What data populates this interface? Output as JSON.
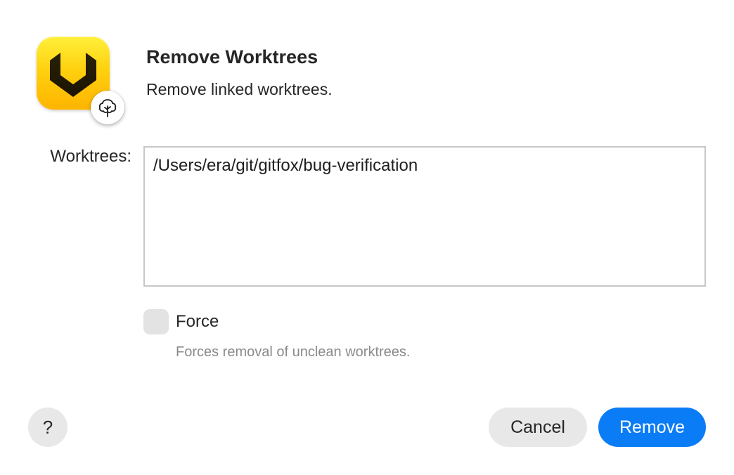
{
  "dialog": {
    "title": "Remove Worktrees",
    "subtitle": "Remove linked worktrees."
  },
  "icons": {
    "app": "gitfox-app-icon",
    "badge": "tree-icon"
  },
  "form": {
    "worktrees_label": "Worktrees:",
    "worktrees_value": "/Users/era/git/gitfox/bug-verification",
    "force_label": "Force",
    "force_checked": false,
    "force_help": "Forces removal of unclean worktrees."
  },
  "buttons": {
    "help": "?",
    "cancel": "Cancel",
    "remove": "Remove"
  },
  "colors": {
    "accent": "#0a7cf6",
    "app_icon": "#ffd10f"
  }
}
